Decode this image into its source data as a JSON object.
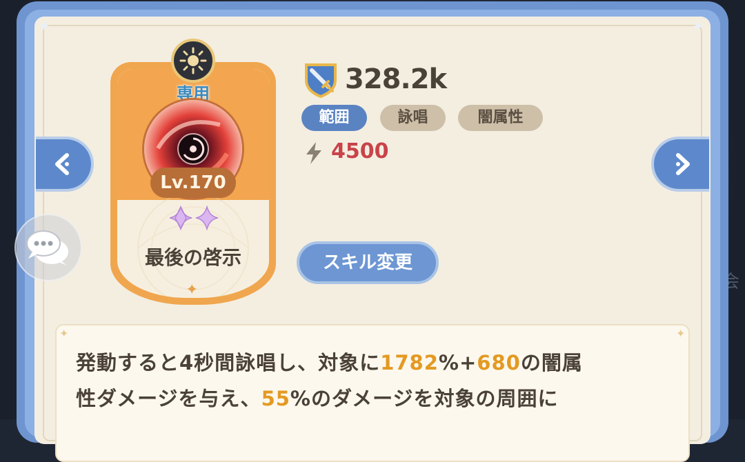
{
  "skill": {
    "exclusive_label": "専用",
    "level": "Lv.170",
    "name": "最後の啓示",
    "stars": 2
  },
  "stats": {
    "power": "328.2k",
    "cost": "4500"
  },
  "tags": [
    "範囲",
    "詠唱",
    "闇属性"
  ],
  "buttons": {
    "change_skill": "スキル変更"
  },
  "description": {
    "line1_a": "発動すると4秒間詠唱し、対象に",
    "line1_hl1": "1782",
    "line1_b": "%+",
    "line1_hl2": "680",
    "line1_c": "の闇属",
    "line2_a": "性ダメージを与え、",
    "line2_hl1": "55",
    "line2_b": "%のダメージを対象の周囲に"
  },
  "side_text": "会",
  "colors": {
    "accent_blue": "#5a83c2",
    "card_orange": "#f0a64e",
    "highlight": "#e39a23",
    "energy_red": "#c9434a"
  },
  "icons": {
    "power": "shield-sword-icon",
    "energy": "lightning-icon",
    "element": "sun-icon",
    "chat": "chat-bubble-icon"
  }
}
